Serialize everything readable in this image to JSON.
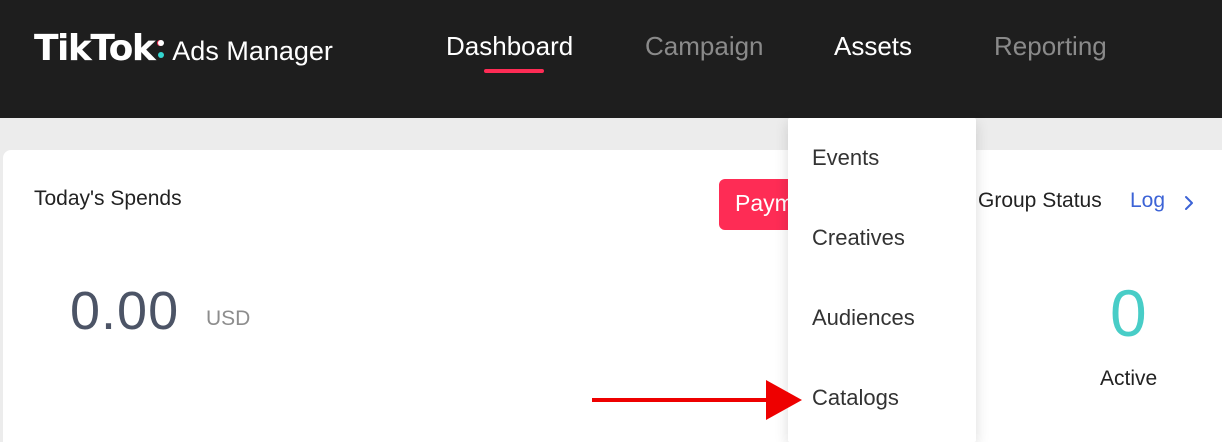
{
  "header": {
    "logo_brand": "TikTok",
    "logo_product": "Ads Manager",
    "tabs": [
      {
        "label": "Dashboard",
        "active": true
      },
      {
        "label": "Campaign",
        "active": false
      },
      {
        "label": "Assets",
        "active": false
      },
      {
        "label": "Reporting",
        "active": false
      }
    ]
  },
  "spends": {
    "title": "Today's Spends",
    "value": "0.00",
    "unit": "USD"
  },
  "payment": {
    "label": "Payment"
  },
  "status": {
    "title": "Group Status",
    "log_label": "Log",
    "count": "0",
    "label": "Active"
  },
  "assets_menu": {
    "items": [
      "Events",
      "Creatives",
      "Audiences",
      "Catalogs"
    ]
  },
  "colors": {
    "topbar": "#1e1e1e",
    "accent_red": "#fe2c55",
    "accent_teal": "#48cdc7",
    "link_blue": "#3c63d6",
    "arrow": "#ee0000"
  },
  "icons": [
    "chevron-right-icon",
    "pointer-arrow-icon"
  ]
}
